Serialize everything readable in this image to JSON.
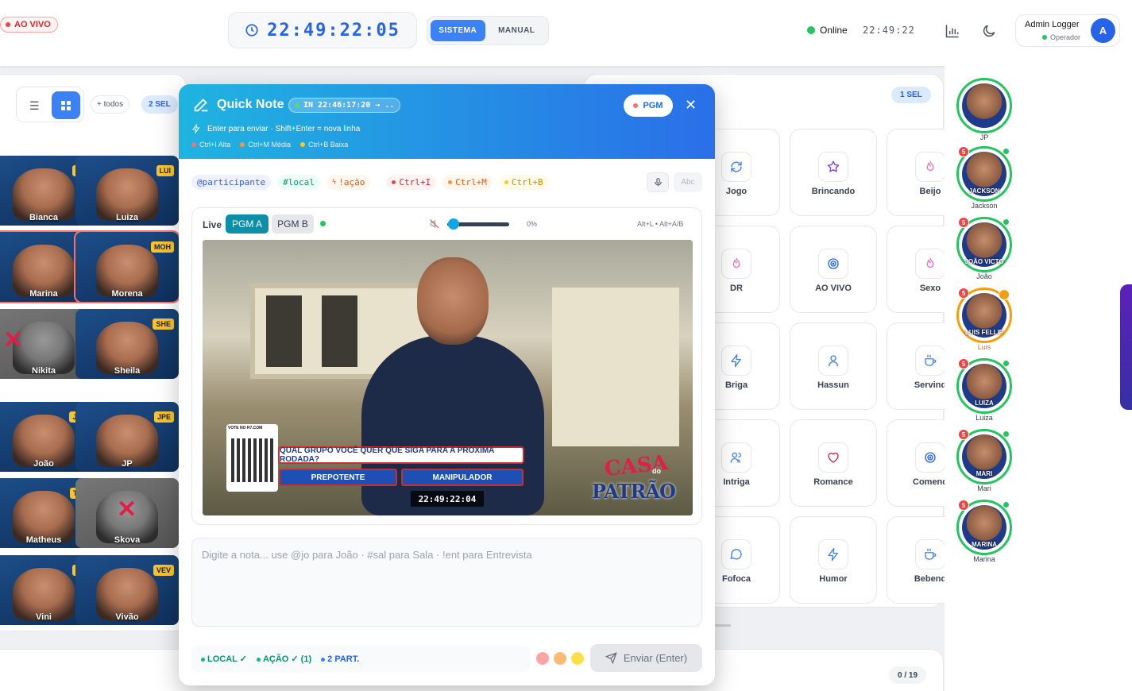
{
  "topbar": {
    "live_label": "AO VIVO",
    "clock": "22:49:22:05",
    "mode_system": "SISTEMA",
    "mode_manual": "MANUAL",
    "online_label": "Online",
    "online_time": "22:49:22",
    "user_name": "Admin Logger",
    "user_role": "Operador",
    "user_initial": "A"
  },
  "left_panel": {
    "filter_all": "+ todos",
    "selected_count": "2 SEL",
    "cards": [
      {
        "name": "Bianca",
        "tag": "BIA"
      },
      {
        "name": "Luiza",
        "tag": "LUI"
      },
      {
        "name": "Marina",
        "tag": ""
      },
      {
        "name": "Morena",
        "tag": "MOH"
      },
      {
        "name": "Nikita",
        "tag": ""
      },
      {
        "name": "Sheila",
        "tag": "SHE"
      },
      {
        "name": "João",
        "tag": "JOK"
      },
      {
        "name": "JP",
        "tag": "JPE"
      },
      {
        "name": "Matheus",
        "tag": "THE"
      },
      {
        "name": "Skova",
        "tag": ""
      },
      {
        "name": "Vini",
        "tag": "VIH"
      },
      {
        "name": "Vivão",
        "tag": "VEV"
      }
    ]
  },
  "modal": {
    "title": "Quick Note",
    "in_chip": "IN 22:46:17:20 → ..",
    "pgm_label": "PGM",
    "hint": "Enter para enviar · Shift+Enter = nova linha",
    "priority_high": "Ctrl+I Alta",
    "priority_mid": "Ctrl+M Média",
    "priority_low": "Ctrl+B Baixa",
    "tag_participant": "@participante",
    "tag_local": "#local",
    "tag_action": "!ação",
    "tag_ctrl_i": "Ctrl+I",
    "tag_ctrl_m": "Ctrl+M",
    "tag_ctrl_b": "Ctrl+B",
    "abc_label": "Abc",
    "video": {
      "live_label": "Live",
      "pgm_a": "PGM A",
      "pgm_b": "PGM B",
      "volume_pct": "0%",
      "shortcuts": "Alt+L • Alt+A/B",
      "vote_site": "VOTE NO R7.COM",
      "question": "QUAL GRUPO VOCÊ QUER QUE SIGA PARA A PRÓXIMA RODADA?",
      "option_a": "PREPOTENTE",
      "option_b": "MANIPULADOR",
      "timecode": "22:49:22:04",
      "logo_main": "CASA",
      "logo_small": "do",
      "logo_sub": "PATRÃO"
    },
    "textarea_placeholder": "Digite a nota...  use @jo para João · #sal para Sala · !ent para Entrevista",
    "status_local": "LOCAL ✓",
    "status_action": "AÇÃO ✓ (1)",
    "status_part": "2 PART.",
    "send_label": "Enviar (Enter)"
  },
  "middle_panel": {
    "selected_count": "1 SEL",
    "counter": "0 / 19",
    "tiles": [
      {
        "label": "Jogo",
        "icon": "refresh-icon"
      },
      {
        "label": "Brincando",
        "icon": "star-icon"
      },
      {
        "label": "Beijo",
        "icon": "flame-icon"
      },
      {
        "label": "DR",
        "icon": "flame-icon"
      },
      {
        "label": "AO VIVO",
        "icon": "target-icon"
      },
      {
        "label": "Sexo",
        "icon": "flame-icon"
      },
      {
        "label": "Briga",
        "icon": "bolt-icon"
      },
      {
        "label": "Hassun",
        "icon": "person-icon"
      },
      {
        "label": "Servind",
        "icon": "cup-icon"
      },
      {
        "label": "Intriga",
        "icon": "people-icon"
      },
      {
        "label": "Romance",
        "icon": "heart-icon"
      },
      {
        "label": "Comend",
        "icon": "target-icon"
      },
      {
        "label": "Fofoca",
        "icon": "chat-icon"
      },
      {
        "label": "Humor",
        "icon": "bolt-icon"
      },
      {
        "label": "Bebend",
        "icon": "cup-icon"
      }
    ]
  },
  "right_sidebar": {
    "participants": [
      {
        "label": "JP",
        "overlay": ""
      },
      {
        "label": "Jackson",
        "overlay": "JACKSON",
        "badge": "5"
      },
      {
        "label": "João",
        "overlay": "JOÃO VICTO",
        "badge": "5"
      },
      {
        "label": "Luis",
        "overlay": "LUIS FELLIP",
        "badge": "5"
      },
      {
        "label": "Luiza",
        "overlay": "LUIZA",
        "badge": "5"
      },
      {
        "label": "Mari",
        "overlay": "MARI",
        "badge": "5"
      },
      {
        "label": "Marina",
        "overlay": "MARINA",
        "badge": "5"
      }
    ]
  },
  "colors": {
    "accent": "#3b82f6",
    "live_red": "#dc2626",
    "online_green": "#22c55e",
    "header_gradient_start": "#1fb4e0",
    "header_gradient_end": "#2a6fe8"
  }
}
